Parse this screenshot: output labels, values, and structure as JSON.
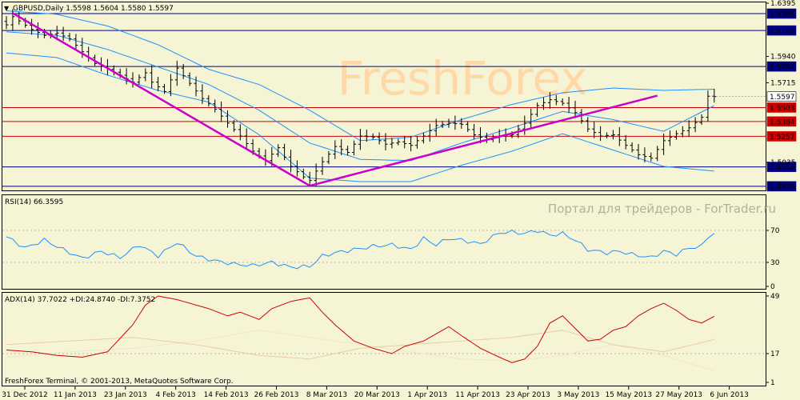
{
  "header": {
    "symbol_line": "GBPUSD,Daily  1.5598 1.5604 1.5580 1.5597"
  },
  "watermarks": {
    "brand": "FreshForex",
    "portal": "Портал для трейдеров - ForTrader.ru"
  },
  "footer": "FreshForex Terminal, © 2001-2013, MetaQuotes Software Corp.",
  "colors": {
    "background": "#f5f5d5",
    "price_bars": "#000000",
    "bollinger": "#1e90ff",
    "trendline": "#cc00cc",
    "hline_blue": "#000080",
    "hline_red": "#cc0000",
    "rsi_line": "#1e90ff",
    "adx_line": "#cc0000",
    "di_plus": "#e8c8a0",
    "di_minus": "#f2e2c8",
    "watermark": "#ffd8a8"
  },
  "chart_data": [
    {
      "type": "ohlc",
      "name": "price",
      "title": "GBPUSD,Daily",
      "ohlc_last": {
        "open": 1.5598,
        "high": 1.5604,
        "low": 1.558,
        "close": 1.5597
      },
      "ylim": [
        1.4795,
        1.6395
      ],
      "y_ticks": [
        "1.6395",
        "1.5940",
        "1.5715",
        "1.5035"
      ],
      "x_ticks": [
        "31 Dec 2012",
        "11 Jan 2013",
        "23 Jan 2013",
        "4 Feb 2013",
        "14 Feb 2013",
        "26 Feb 2013",
        "8 Mar 2013",
        "20 Mar 2013",
        "1 Apr 2013",
        "11 Apr 2013",
        "23 Apr 2013",
        "3 May 2013",
        "15 May 2013",
        "27 May 2013",
        "6 Jun 2013"
      ],
      "levels": [
        {
          "value": 1.6306,
          "label": "1.6306",
          "color": "#000080"
        },
        {
          "value": 1.6162,
          "label": "1.6162",
          "color": "#000080"
        },
        {
          "value": 1.5854,
          "label": "1.5854",
          "color": "#000080"
        },
        {
          "value": 1.5597,
          "label": "1.5597",
          "color": "#000000",
          "current": true
        },
        {
          "value": 1.5503,
          "label": "1.5503",
          "color": "#cc0000"
        },
        {
          "value": 1.5384,
          "label": "1.5384",
          "color": "#cc0000"
        },
        {
          "value": 1.5257,
          "label": "1.5257",
          "color": "#cc0000"
        },
        {
          "value": 1.4996,
          "label": "1.4996",
          "color": "#000080"
        },
        {
          "value": 1.483,
          "label": "1.4830",
          "color": "#000080"
        }
      ],
      "trendlines": [
        {
          "from": {
            "bar": 1,
            "price": 1.631
          },
          "to": {
            "bar": 48,
            "price": 1.4835
          }
        },
        {
          "from": {
            "bar": 48,
            "price": 1.4835
          },
          "to": {
            "bar": 103,
            "price": 1.5605
          }
        }
      ],
      "bar_count": 118,
      "close_anchors": [
        [
          0,
          1.621
        ],
        [
          1,
          1.628
        ],
        [
          4,
          1.617
        ],
        [
          6,
          1.612
        ],
        [
          8,
          1.614
        ],
        [
          10,
          1.609
        ],
        [
          12,
          1.598
        ],
        [
          14,
          1.588
        ],
        [
          16,
          1.583
        ],
        [
          18,
          1.578
        ],
        [
          20,
          1.572
        ],
        [
          22,
          1.58
        ],
        [
          23,
          1.572
        ],
        [
          25,
          1.564
        ],
        [
          27,
          1.584
        ],
        [
          29,
          1.571
        ],
        [
          31,
          1.558
        ],
        [
          33,
          1.549
        ],
        [
          35,
          1.537
        ],
        [
          37,
          1.526
        ],
        [
          39,
          1.513
        ],
        [
          41,
          1.505
        ],
        [
          43,
          1.516
        ],
        [
          45,
          1.5
        ],
        [
          47,
          1.491
        ],
        [
          48,
          1.488
        ],
        [
          50,
          1.504
        ],
        [
          52,
          1.517
        ],
        [
          54,
          1.512
        ],
        [
          56,
          1.526
        ],
        [
          58,
          1.525
        ],
        [
          60,
          1.519
        ],
        [
          62,
          1.521
        ],
        [
          64,
          1.518
        ],
        [
          66,
          1.526
        ],
        [
          68,
          1.535
        ],
        [
          70,
          1.537
        ],
        [
          72,
          1.536
        ],
        [
          74,
          1.527
        ],
        [
          76,
          1.523
        ],
        [
          78,
          1.526
        ],
        [
          80,
          1.527
        ],
        [
          82,
          1.537
        ],
        [
          84,
          1.552
        ],
        [
          86,
          1.557
        ],
        [
          88,
          1.554
        ],
        [
          90,
          1.546
        ],
        [
          92,
          1.532
        ],
        [
          94,
          1.526
        ],
        [
          96,
          1.527
        ],
        [
          98,
          1.518
        ],
        [
          100,
          1.51
        ],
        [
          102,
          1.507
        ],
        [
          104,
          1.522
        ],
        [
          106,
          1.528
        ],
        [
          108,
          1.533
        ],
        [
          110,
          1.542
        ],
        [
          111,
          1.56
        ],
        [
          112,
          1.5597
        ]
      ],
      "bollinger": {
        "middle": [
          [
            0,
            1.615
          ],
          [
            8,
            1.612
          ],
          [
            16,
            1.6
          ],
          [
            24,
            1.585
          ],
          [
            32,
            1.57
          ],
          [
            40,
            1.548
          ],
          [
            48,
            1.52
          ],
          [
            56,
            1.506
          ],
          [
            64,
            1.505
          ],
          [
            72,
            1.52
          ],
          [
            80,
            1.533
          ],
          [
            88,
            1.547
          ],
          [
            96,
            1.54
          ],
          [
            104,
            1.53
          ],
          [
            112,
            1.552
          ]
        ],
        "upper": [
          [
            0,
            1.633
          ],
          [
            8,
            1.63
          ],
          [
            16,
            1.62
          ],
          [
            24,
            1.604
          ],
          [
            32,
            1.583
          ],
          [
            40,
            1.57
          ],
          [
            48,
            1.548
          ],
          [
            56,
            1.522
          ],
          [
            64,
            1.525
          ],
          [
            72,
            1.54
          ],
          [
            80,
            1.553
          ],
          [
            88,
            1.563
          ],
          [
            96,
            1.567
          ],
          [
            104,
            1.565
          ],
          [
            112,
            1.566
          ]
        ],
        "lower": [
          [
            0,
            1.597
          ],
          [
            8,
            1.593
          ],
          [
            16,
            1.578
          ],
          [
            24,
            1.565
          ],
          [
            32,
            1.555
          ],
          [
            40,
            1.527
          ],
          [
            48,
            1.49
          ],
          [
            56,
            1.487
          ],
          [
            64,
            1.487
          ],
          [
            72,
            1.501
          ],
          [
            80,
            1.513
          ],
          [
            88,
            1.528
          ],
          [
            96,
            1.514
          ],
          [
            104,
            1.5
          ],
          [
            112,
            1.496
          ]
        ]
      }
    },
    {
      "type": "line",
      "name": "rsi",
      "title": "RSI(14) 66.3595",
      "ylim": [
        0,
        100
      ],
      "y_ticks": [
        "70",
        "30",
        "0"
      ],
      "levels": [
        70,
        30
      ],
      "anchors": [
        [
          0,
          62
        ],
        [
          3,
          48
        ],
        [
          6,
          58
        ],
        [
          9,
          46
        ],
        [
          12,
          35
        ],
        [
          15,
          44
        ],
        [
          18,
          36
        ],
        [
          21,
          52
        ],
        [
          24,
          38
        ],
        [
          27,
          55
        ],
        [
          30,
          38
        ],
        [
          33,
          32
        ],
        [
          36,
          28
        ],
        [
          39,
          26
        ],
        [
          42,
          30
        ],
        [
          45,
          24
        ],
        [
          48,
          25
        ],
        [
          50,
          38
        ],
        [
          52,
          42
        ],
        [
          55,
          46
        ],
        [
          58,
          50
        ],
        [
          61,
          52
        ],
        [
          64,
          46
        ],
        [
          66,
          60
        ],
        [
          68,
          52
        ],
        [
          70,
          60
        ],
        [
          72,
          58
        ],
        [
          75,
          53
        ],
        [
          78,
          67
        ],
        [
          80,
          68
        ],
        [
          82,
          66
        ],
        [
          84,
          70
        ],
        [
          86,
          64
        ],
        [
          88,
          66
        ],
        [
          90,
          58
        ],
        [
          92,
          46
        ],
        [
          95,
          42
        ],
        [
          97,
          44
        ],
        [
          99,
          40
        ],
        [
          102,
          36
        ],
        [
          104,
          44
        ],
        [
          106,
          40
        ],
        [
          108,
          48
        ],
        [
          110,
          50
        ],
        [
          111,
          62
        ],
        [
          112,
          66.3595
        ]
      ]
    },
    {
      "type": "line",
      "name": "adx",
      "title": "ADX(14) 37.7022 +DI:24.8740 -DI:7.3752",
      "ylim": [
        1,
        49
      ],
      "y_ticks": [
        "49",
        "17",
        "1"
      ],
      "series": [
        {
          "name": "ADX(14)",
          "last": 37.7022,
          "anchors": [
            [
              0,
              19
            ],
            [
              4,
              18
            ],
            [
              8,
              16
            ],
            [
              12,
              15
            ],
            [
              16,
              18
            ],
            [
              20,
              33
            ],
            [
              22,
              44
            ],
            [
              24,
              49
            ],
            [
              27,
              47
            ],
            [
              30,
              44
            ],
            [
              32,
              42
            ],
            [
              35,
              38
            ],
            [
              37,
              40
            ],
            [
              40,
              36
            ],
            [
              42,
              42
            ],
            [
              45,
              46
            ],
            [
              48,
              48
            ],
            [
              50,
              40
            ],
            [
              52,
              33
            ],
            [
              55,
              24
            ],
            [
              58,
              20
            ],
            [
              61,
              17
            ],
            [
              63,
              21
            ],
            [
              66,
              24
            ],
            [
              68,
              28
            ],
            [
              70,
              32
            ],
            [
              72,
              27
            ],
            [
              75,
              20
            ],
            [
              78,
              15
            ],
            [
              80,
              12
            ],
            [
              82,
              14
            ],
            [
              84,
              21
            ],
            [
              86,
              34
            ],
            [
              88,
              38
            ],
            [
              90,
              31
            ],
            [
              92,
              24
            ],
            [
              94,
              25
            ],
            [
              96,
              30
            ],
            [
              98,
              32
            ],
            [
              100,
              38
            ],
            [
              102,
              42
            ],
            [
              104,
              45
            ],
            [
              106,
              41
            ],
            [
              108,
              36
            ],
            [
              110,
              34
            ],
            [
              112,
              37.7022
            ]
          ]
        },
        {
          "name": "+DI",
          "last": 24.874,
          "anchors": [
            [
              0,
              22
            ],
            [
              10,
              24
            ],
            [
              20,
              26
            ],
            [
              30,
              22
            ],
            [
              40,
              16
            ],
            [
              48,
              14
            ],
            [
              56,
              20
            ],
            [
              64,
              22
            ],
            [
              72,
              24
            ],
            [
              80,
              26
            ],
            [
              88,
              30
            ],
            [
              96,
              22
            ],
            [
              104,
              18
            ],
            [
              112,
              24.874
            ]
          ]
        },
        {
          "name": "-DI",
          "last": 7.3752,
          "anchors": [
            [
              0,
              15
            ],
            [
              10,
              18
            ],
            [
              20,
              20
            ],
            [
              30,
              24
            ],
            [
              40,
              30
            ],
            [
              48,
              26
            ],
            [
              56,
              22
            ],
            [
              64,
              18
            ],
            [
              72,
              14
            ],
            [
              80,
              13
            ],
            [
              88,
              16
            ],
            [
              96,
              22
            ],
            [
              104,
              16
            ],
            [
              112,
              7.3752
            ]
          ]
        }
      ]
    }
  ]
}
